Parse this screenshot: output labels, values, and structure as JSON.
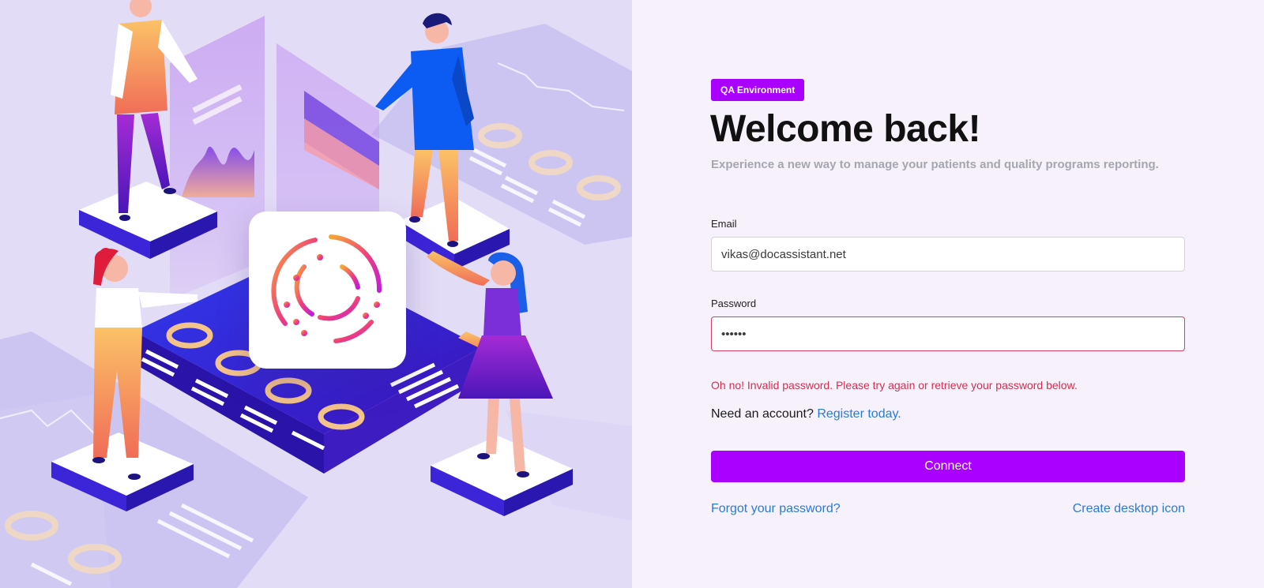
{
  "hero": {
    "logo_icon": "circular-dots-logo",
    "colors": {
      "background": "#e3dcf6",
      "platform": "#3b1fd0",
      "accent_orange": "#f5a15a",
      "accent_magenta": "#d21fbf"
    }
  },
  "login": {
    "badge": "QA Environment",
    "title": "Welcome back!",
    "subtitle": "Experience a new way to manage your patients and quality programs reporting.",
    "email": {
      "label": "Email",
      "value": "vikas@docassistant.net"
    },
    "password": {
      "label": "Password",
      "value": "••••••"
    },
    "error": "Oh no! Invalid password. Please try again or retrieve your password below.",
    "need_account": "Need an account?",
    "register_link": "Register today.",
    "connect_button": "Connect",
    "forgot_link": "Forgot your password?",
    "desktop_link": "Create desktop icon"
  },
  "colors": {
    "brand": "#aa00ff",
    "link": "#2a7bd8",
    "error": "#d13050",
    "panel_bg": "#f7f1fc"
  }
}
